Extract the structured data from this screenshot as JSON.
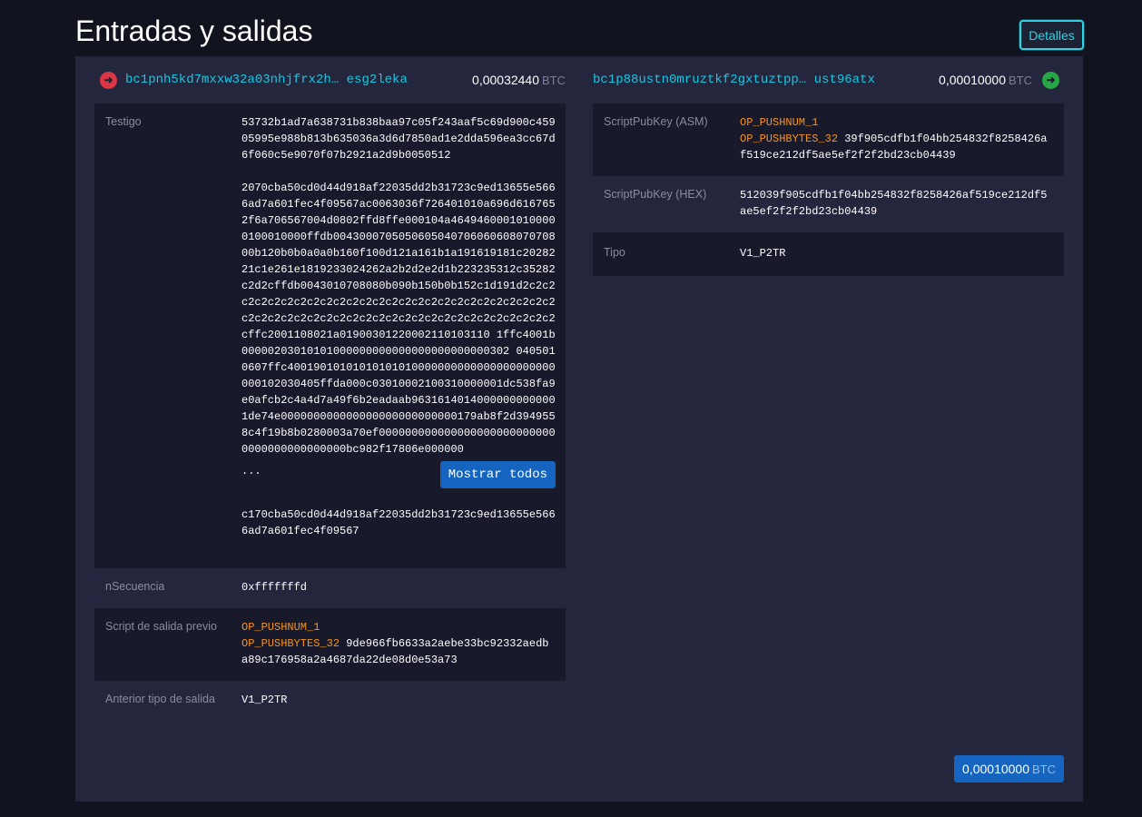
{
  "header": {
    "title": "Entradas y salidas",
    "details_label": "Detalles"
  },
  "input": {
    "address": "bc1pnh5kd7mxxw32a03nhjfrx2h… esg2leka",
    "amount": "0,00032440",
    "unit": "BTC",
    "witness_label": "Testigo",
    "witness": [
      "53732b1ad7a638731b838baa97c05f243aaf5c69d900c45905995e988b813b635036a3d6d7850ad1e2dda596ea3cc67d6f060c5e9070f07b2921a2d9b0050512",
      "2070cba50cd0d44d918af22035dd2b31723c9ed13655e5666ad7a601fec4f09567ac0063036f726401010a696d6167652f6a706567004d0802ffd8ffe000104a46494600010100000100010000ffdb004300070505060504070606060807070800b120b0b0a0a0b160f100d121a161b1a191619181c2028221c1e261e1819233024262a2b2d2e2d1b223235312c35282c2d2cffdb0043010708080b090b150b0b152c1d191d2c2c2c2c2c2c2c2c2c2c2c2c2c2c2c2c2c2c2c2c2c2c2c2c2c2c2c2c2c2c2c2c2c2c2c2c2c2c2c2c2c2c2c2c2c2c2c2c2c2c2cffc2001108021a01900301220002110103110 1ffc4001b00000203010101000000000000000000000000302 0405010607ffc40019010101010101010000000000000000000000000102030405ffda000c03010002100310000001dc538fa9e0afcb2c4a4d7a49f6b2eadaab96316140140000000000001de74e000000000000000000000000000179ab8f2d3949558c4f19b8b0280003a70ef0000000000000000000000000000000000000000000bc982f17806e000000",
      "c170cba50cd0d44d918af22035dd2b31723c9ed13655e5666ad7a601fec4f09567"
    ],
    "ellipsis": "...",
    "show_all_label": "Mostrar todos",
    "sequence_label": "nSecuencia",
    "sequence": "0xfffffffd",
    "prevout_label": "Script de salida previo",
    "prevout_op1": "OP_PUSHNUM_1",
    "prevout_op2": "OP_PUSHBYTES_32",
    "prevout_data": "9de966fb6633a2aebe33bc92332aedba89c176958a2a4687da22de08d0e53a73",
    "prevtype_label": "Anterior tipo de salida",
    "prevtype": "V1_P2TR"
  },
  "output": {
    "address": "bc1p88ustn0mruztkf2gxtuztpp… ust96atx",
    "amount": "0,00010000",
    "unit": "BTC",
    "asm_label": "ScriptPubKey (ASM)",
    "asm_op1": "OP_PUSHNUM_1",
    "asm_op2": "OP_PUSHBYTES_32",
    "asm_data": "39f905cdfb1f04bb254832f8258426af519ce212df5ae5ef2f2f2bd23cb04439",
    "hex_label": "ScriptPubKey (HEX)",
    "hex": "512039f905cdfb1f04bb254832f8258426af519ce212df5ae5ef2f2f2bd23cb04439",
    "type_label": "Tipo",
    "type": "V1_P2TR"
  },
  "total": {
    "amount": "0,00010000",
    "unit": "BTC"
  }
}
